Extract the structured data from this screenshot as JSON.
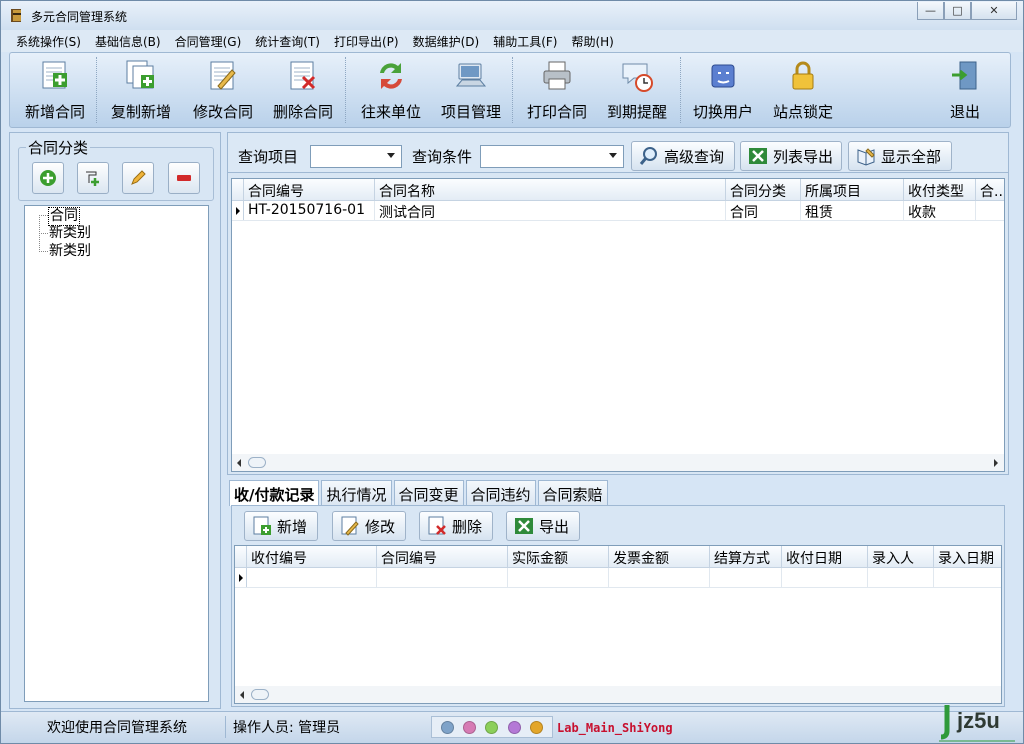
{
  "window": {
    "title": "多元合同管理系统"
  },
  "menu": [
    "系统操作(S)",
    "基础信息(B)",
    "合同管理(G)",
    "统计查询(T)",
    "打印导出(P)",
    "数据维护(D)",
    "辅助工具(F)",
    "帮助(H)"
  ],
  "toolbar": {
    "new_contract": "新增合同",
    "copy_new": "复制新增",
    "edit_contract": "修改合同",
    "delete_contract": "删除合同",
    "partners": "往来单位",
    "projects": "项目管理",
    "print_contract": "打印合同",
    "due_reminder": "到期提醒",
    "switch_user": "切换用户",
    "lock_site": "站点锁定",
    "exit": "退出"
  },
  "left": {
    "group_title": "合同分类",
    "tree": [
      "合同",
      "新类别",
      "新类别"
    ]
  },
  "query": {
    "item_label": "查询项目",
    "item_value": "",
    "condition_label": "查询条件",
    "condition_value": "",
    "advanced": "高级查询",
    "export_list": "列表导出",
    "show_all": "显示全部"
  },
  "contracts_grid": {
    "columns": [
      "合同编号",
      "合同名称",
      "合同分类",
      "所属项目",
      "收付类型",
      "合..."
    ],
    "rows": [
      [
        "HT-20150716-01",
        "测试合同",
        "合同",
        "租赁",
        "收款",
        ""
      ]
    ]
  },
  "tabs": [
    "收/付款记录",
    "执行情况",
    "合同变更",
    "合同违约",
    "合同索赔"
  ],
  "payments": {
    "add": "新增",
    "edit": "修改",
    "delete": "删除",
    "export": "导出",
    "columns": [
      "收付编号",
      "合同编号",
      "实际金额",
      "发票金额",
      "结算方式",
      "收付日期",
      "录入人",
      "录入日期"
    ]
  },
  "status": {
    "welcome": "欢迎使用合同管理系统",
    "operator": "操作人员: 管理员",
    "dot_colors": [
      "#7fa3c9",
      "#d67bb4",
      "#8ccf5a",
      "#b479d6",
      "#e3a62a"
    ],
    "lab": "Lab_Main_ShiYong"
  },
  "watermark": "jz5u"
}
